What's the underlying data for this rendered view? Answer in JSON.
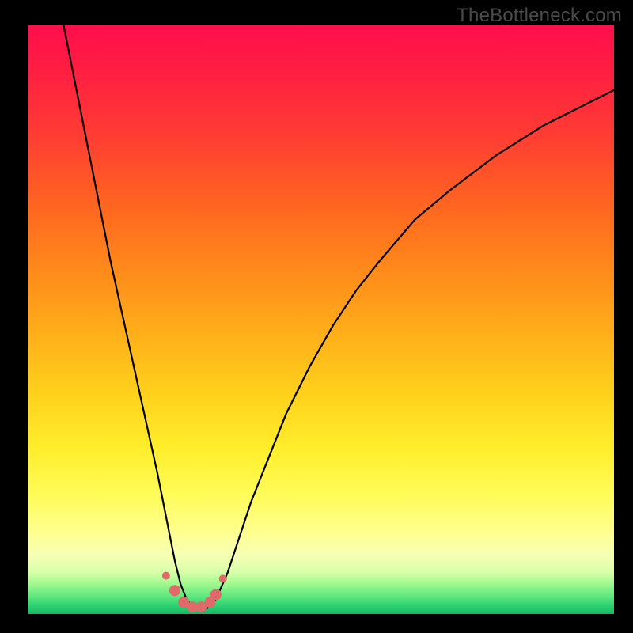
{
  "watermark": "TheBottleneck.com",
  "chart_data": {
    "type": "line",
    "title": "",
    "xlabel": "",
    "ylabel": "",
    "xlim": [
      0,
      100
    ],
    "ylim": [
      0,
      100
    ],
    "series": [
      {
        "name": "bottleneck-curve",
        "x": [
          6,
          8,
          10,
          12,
          14,
          16,
          18,
          20,
          22,
          23,
          24,
          25,
          26,
          27,
          28,
          29,
          30,
          31,
          32,
          34,
          36,
          38,
          40,
          44,
          48,
          52,
          56,
          60,
          66,
          72,
          80,
          88,
          96,
          100
        ],
        "values": [
          100,
          90,
          80,
          70,
          60,
          51,
          42,
          33,
          24,
          19,
          14,
          9,
          5,
          2.5,
          1.2,
          0.8,
          0.8,
          1.2,
          2.5,
          7,
          13,
          19,
          24,
          34,
          42,
          49,
          55,
          60,
          67,
          72,
          78,
          83,
          87,
          89
        ]
      }
    ],
    "markers": {
      "name": "bottom-markers",
      "color": "#e06a6a",
      "points": [
        {
          "x": 23.5,
          "y": 6.5,
          "r": 1.0
        },
        {
          "x": 25.0,
          "y": 4.0,
          "r": 1.4
        },
        {
          "x": 26.5,
          "y": 2.0,
          "r": 1.4
        },
        {
          "x": 28.0,
          "y": 1.2,
          "r": 1.4
        },
        {
          "x": 29.5,
          "y": 1.2,
          "r": 1.4
        },
        {
          "x": 31.0,
          "y": 2.0,
          "r": 1.4
        },
        {
          "x": 32.0,
          "y": 3.3,
          "r": 1.4
        },
        {
          "x": 33.2,
          "y": 6.0,
          "r": 1.0
        }
      ]
    },
    "gradient_stops": [
      {
        "pos": 0,
        "color": "#ff0f4c"
      },
      {
        "pos": 18,
        "color": "#ff3a34"
      },
      {
        "pos": 44,
        "color": "#ff921a"
      },
      {
        "pos": 72,
        "color": "#ffee2c"
      },
      {
        "pos": 90,
        "color": "#f6ffb4"
      },
      {
        "pos": 100,
        "color": "#14b964"
      }
    ]
  }
}
